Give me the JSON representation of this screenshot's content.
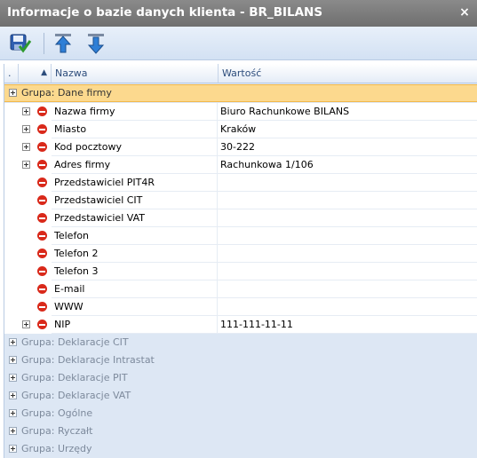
{
  "window": {
    "title": "Informacje o bazie danych klienta - BR_BILANS",
    "close": "×"
  },
  "toolbar": {
    "buttons": [
      {
        "name": "save-button",
        "icon": "save-icon"
      },
      {
        "name": "move-up-button",
        "icon": "arrow-up-icon"
      },
      {
        "name": "move-down-button",
        "icon": "arrow-down-icon"
      }
    ]
  },
  "grid": {
    "columns": {
      "dot": ".",
      "sort_arrow": "▲",
      "name": "Nazwa",
      "value": "Wartość"
    },
    "active_group": {
      "label": "Grupa: Dane firmy",
      "expander": "⊟"
    },
    "rows": [
      {
        "name": "Nazwa firmy",
        "value": "Biuro Rachunkowe BILANS",
        "expandable": true
      },
      {
        "name": "Miasto",
        "value": "Kraków",
        "expandable": true
      },
      {
        "name": "Kod pocztowy",
        "value": "30-222",
        "expandable": true
      },
      {
        "name": "Adres firmy",
        "value": "Rachunkowa 1/106",
        "expandable": true
      },
      {
        "name": "Przedstawiciel PIT4R",
        "value": "",
        "expandable": false
      },
      {
        "name": "Przedstawiciel CIT",
        "value": "",
        "expandable": false
      },
      {
        "name": "Przedstawiciel VAT",
        "value": "",
        "expandable": false
      },
      {
        "name": "Telefon",
        "value": "",
        "expandable": false
      },
      {
        "name": "Telefon 2",
        "value": "",
        "expandable": false
      },
      {
        "name": "Telefon 3",
        "value": "",
        "expandable": false
      },
      {
        "name": "E-mail",
        "value": "",
        "expandable": false
      },
      {
        "name": "WWW",
        "value": "",
        "expandable": false
      },
      {
        "name": "NIP",
        "value": "111-111-11-11",
        "expandable": true
      }
    ],
    "collapsed_groups": [
      "Grupa: Deklaracje CIT",
      "Grupa: Deklaracje Intrastat",
      "Grupa: Deklaracje PIT",
      "Grupa: Deklaracje VAT",
      "Grupa: Ogólne",
      "Grupa: Ryczałt",
      "Grupa: Urzędy"
    ]
  },
  "colors": {
    "title_bg": "#7d7d7d",
    "active_group_bg": "#fcd98e",
    "grid_bg": "#dde7f4",
    "stop_red": "#d9291a"
  }
}
